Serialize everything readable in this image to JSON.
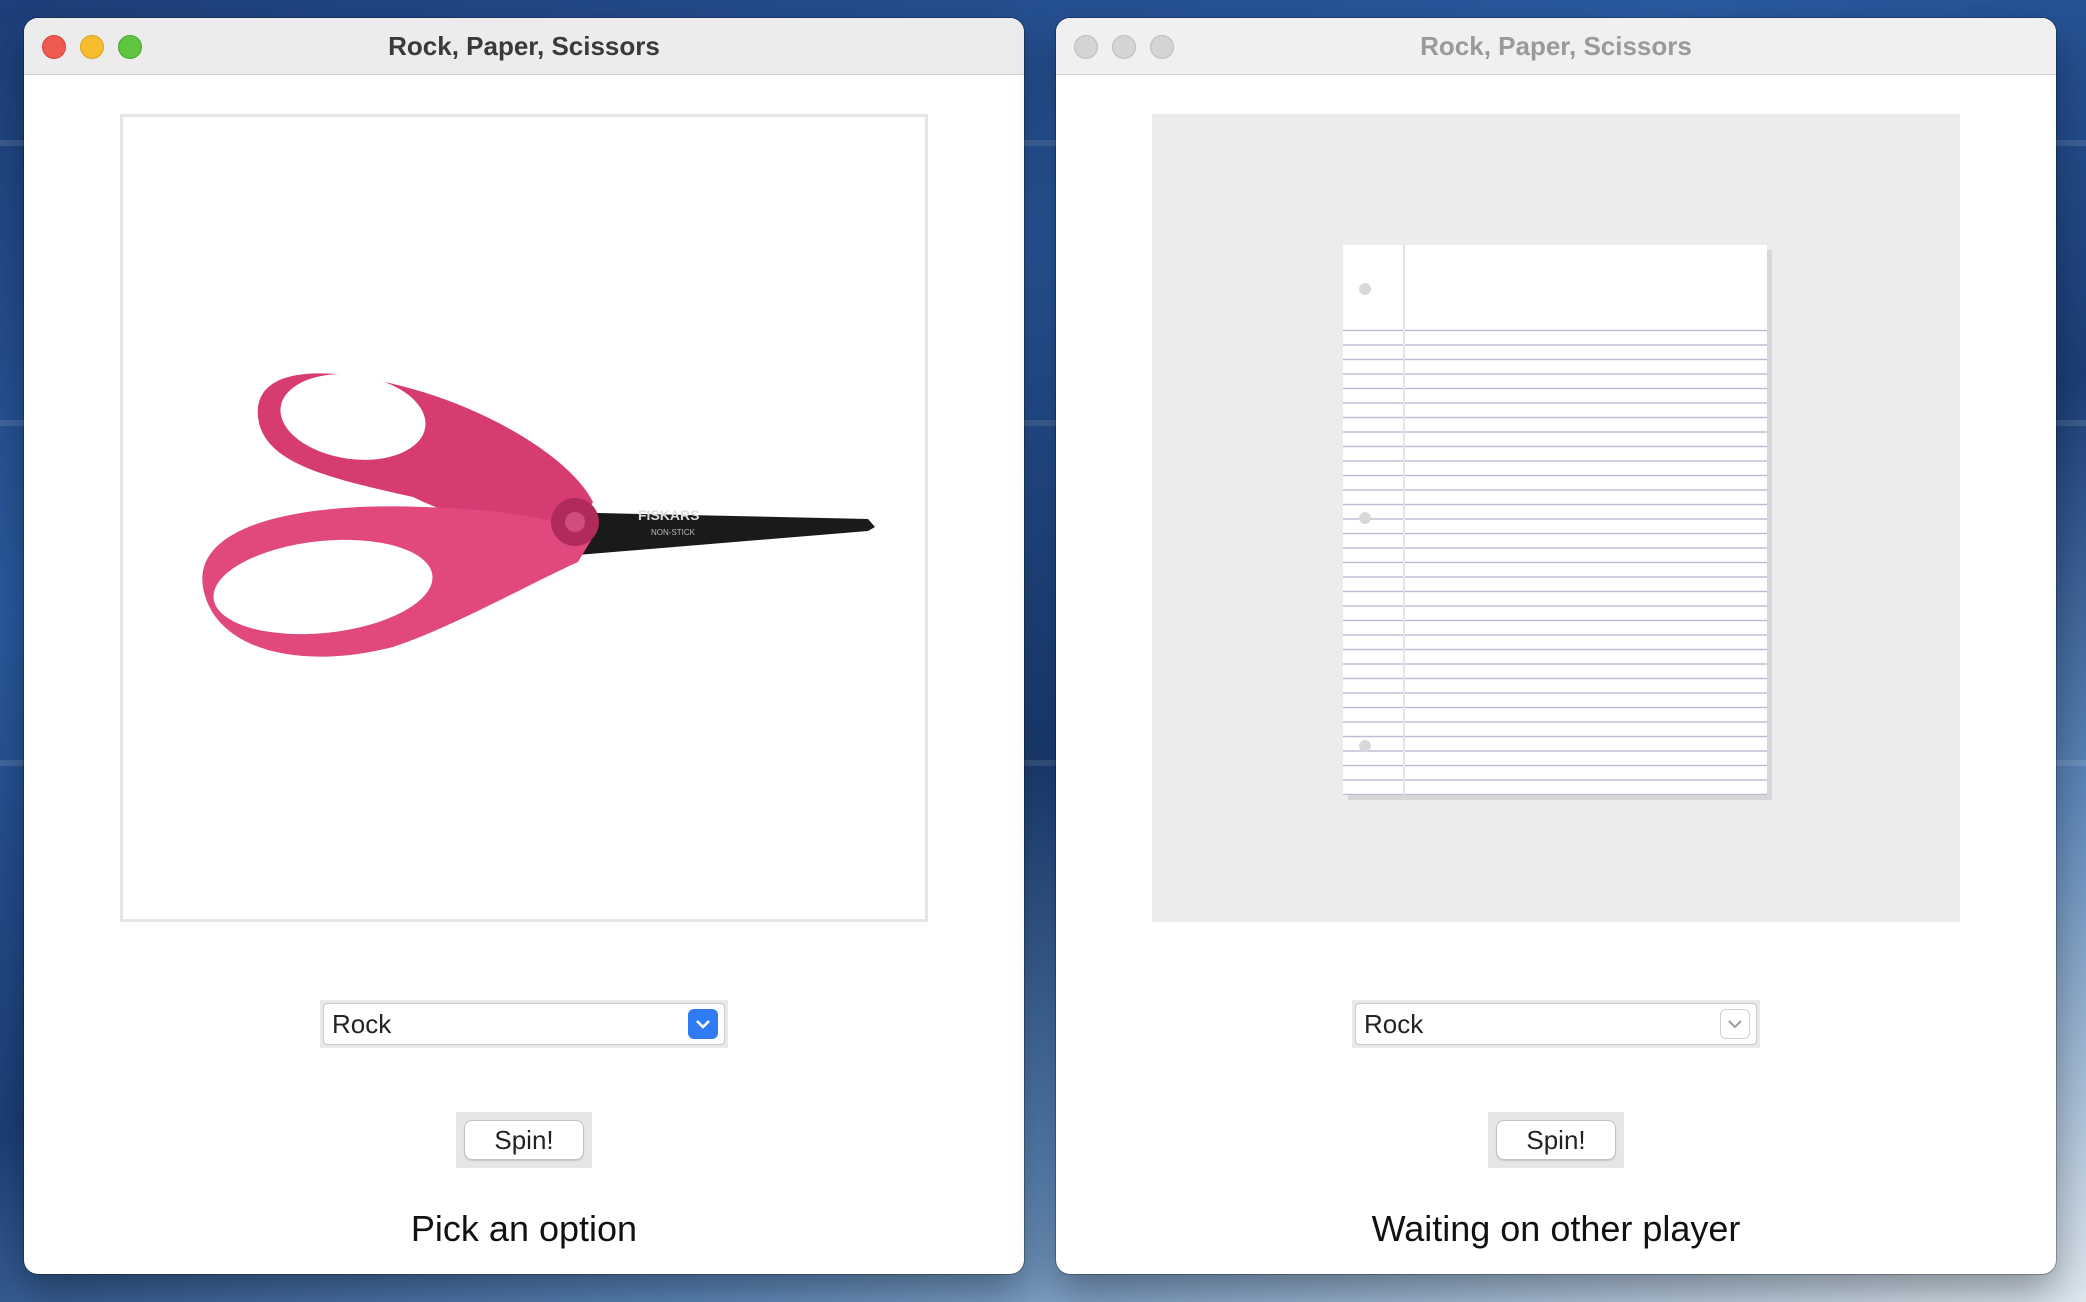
{
  "windows": [
    {
      "title": "Rock, Paper, Scissors",
      "image": "scissors",
      "select_value": "Rock",
      "spin_label": "Spin!",
      "status": "Pick an option",
      "active": true
    },
    {
      "title": "Rock, Paper, Scissors",
      "image": "paper",
      "select_value": "Rock",
      "spin_label": "Spin!",
      "status": "Waiting on other player",
      "active": false
    }
  ],
  "scissors_brand": "FISKARS",
  "scissors_sub": "NON-STICK",
  "icons": {
    "dropdown": "chevron-down-icon"
  },
  "colors": {
    "accent": "#2f7bf5",
    "scissors_handle": "#e0487e"
  }
}
